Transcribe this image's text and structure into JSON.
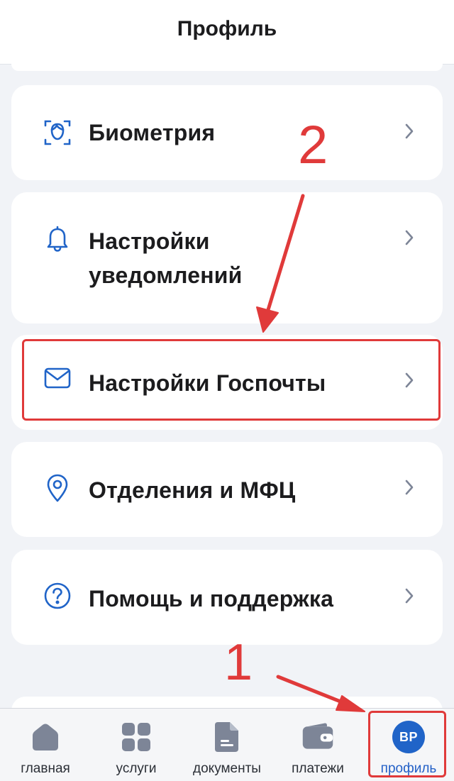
{
  "header": {
    "title": "Профиль"
  },
  "menu": [
    {
      "label": "Биометрия",
      "icon": "face-id-icon"
    },
    {
      "label": "Настройки\nуведомлений",
      "icon": "bell-icon"
    },
    {
      "label": "Настройки Госпочты",
      "icon": "mail-icon"
    },
    {
      "label": "Отделения и МФЦ",
      "icon": "location-pin-icon"
    },
    {
      "label": "Помощь и поддержка",
      "icon": "question-icon"
    }
  ],
  "annotations": {
    "step1": "1",
    "step2": "2"
  },
  "tabbar": {
    "tabs": [
      {
        "label": "главная",
        "icon": "home-icon"
      },
      {
        "label": "услуги",
        "icon": "grid-icon"
      },
      {
        "label": "документы",
        "icon": "document-icon"
      },
      {
        "label": "платежи",
        "icon": "wallet-icon"
      },
      {
        "label": "профиль",
        "icon": "avatar",
        "avatar_initials": "ВР",
        "active": true
      }
    ]
  },
  "colors": {
    "accent": "#2064c8",
    "annotation": "#e03a3a",
    "icon_gray": "#7d8597"
  }
}
